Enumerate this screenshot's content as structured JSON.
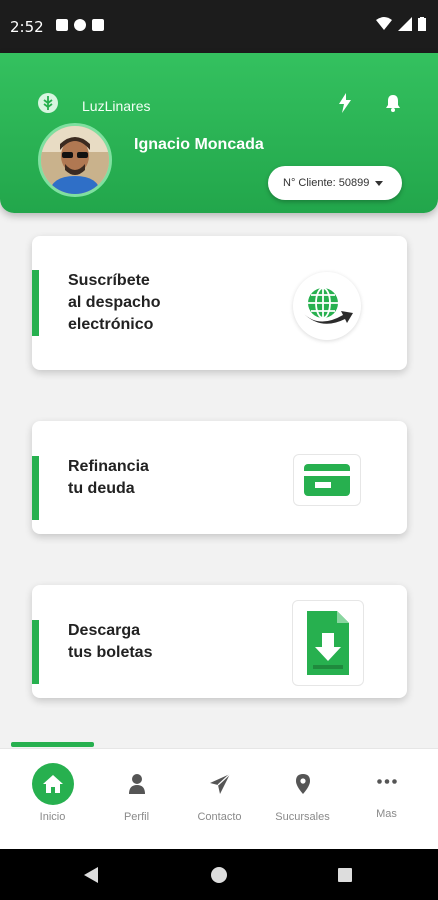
{
  "status_bar": {
    "time": "2:52"
  },
  "header": {
    "brand_name": "LuzLinares",
    "user_name": "Ignacio Moncada",
    "client_selector": "N° Cliente: 50899"
  },
  "cards": [
    {
      "title_lines": [
        "Suscríbete",
        "al despacho",
        "electrónico"
      ],
      "icon": "globe-arrow-icon"
    },
    {
      "title_lines": [
        "Refinancia",
        "tu deuda"
      ],
      "icon": "credit-card-icon"
    },
    {
      "title_lines": [
        "Descarga",
        "tus boletas"
      ],
      "icon": "download-document-icon"
    }
  ],
  "bottom_nav": {
    "items": [
      {
        "label": "Inicio",
        "icon": "home-icon",
        "active": true
      },
      {
        "label": "Perfil",
        "icon": "person-icon"
      },
      {
        "label": "Contacto",
        "icon": "paper-plane-icon"
      },
      {
        "label": "Sucursales",
        "icon": "location-pin-icon"
      },
      {
        "label": "Mas",
        "icon": "more-dots-icon"
      }
    ]
  },
  "colors": {
    "brand_green": "#27b04f",
    "header_green": "#34c15f"
  }
}
